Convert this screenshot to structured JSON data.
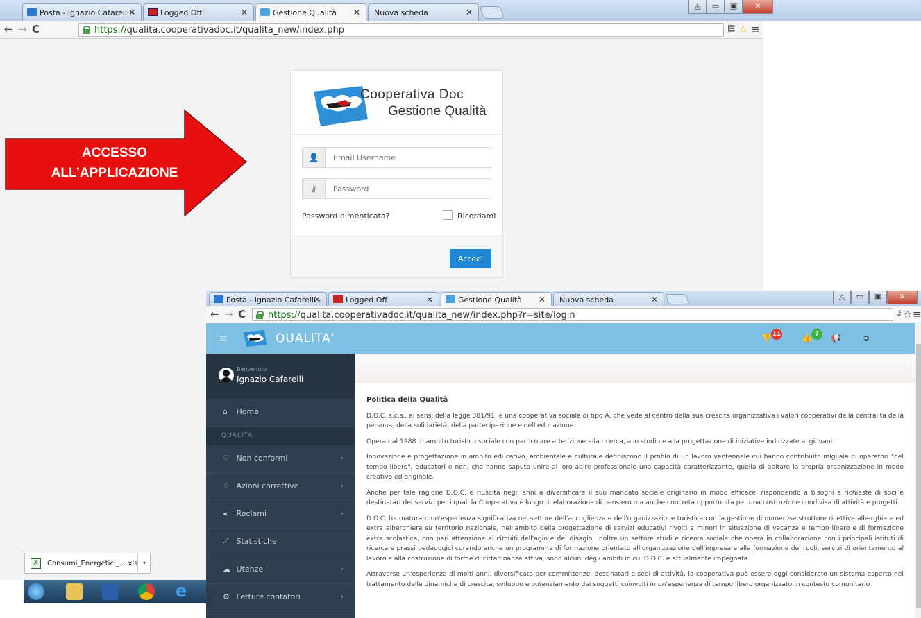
{
  "outer": {
    "tabs": [
      {
        "label": "Posta - Ignazio Cafarelli -",
        "icon": "mail-icon"
      },
      {
        "label": "Logged Off",
        "icon": "page-icon"
      },
      {
        "label": "Gestione Qualità",
        "icon": "doc-logo-icon"
      },
      {
        "label": "Nuova scheda",
        "icon": ""
      }
    ],
    "url_https": "https://",
    "url_rest": "qualita.cooperativadoc.it/qualita_new/index.php"
  },
  "login": {
    "brand_line1": "Cooperativa Doc",
    "brand_line2": "Gestione Qualità",
    "email_placeholder": "Email Username",
    "password_placeholder": "Password",
    "forgot_label": "Password dimenticata?",
    "remember_label": "Ricordami",
    "submit_label": "Accedi"
  },
  "annotation": {
    "line1": "ACCESSO",
    "line2": "ALL’APPLICAZIONE",
    "color": "#e8100f"
  },
  "inner": {
    "tabs": [
      {
        "label": "Posta - Ignazio Cafarelli -"
      },
      {
        "label": "Logged Off"
      },
      {
        "label": "Gestione Qualità"
      },
      {
        "label": "Nuova scheda"
      }
    ],
    "url_https": "https://",
    "url_rest": "qualita.cooperativadoc.it/qualita_new/index.php?r=site/login",
    "app_title": "QUALITA'",
    "header_badges": {
      "nonconformi": "11",
      "azioni": "7"
    },
    "welcome": "Benvenuto",
    "user_name": "Ignazio Cafarelli",
    "menu": {
      "home": "Home",
      "section": "QUALITA",
      "non_conformi": "Non conformi",
      "azioni": "Azioni correttive",
      "reclami": "Reclami",
      "statistiche": "Statistiche",
      "utenze": "Utenze",
      "letture": "Letture contatori"
    },
    "content": {
      "heading": "Politica della Qualità",
      "p1": "D.O.C. s.c.s., ai sensi della legge 381/91, è una cooperativa sociale di tipo A, che vede al centro della sua crescita organizzativa i valori cooperativi della centralità della persona, della solidarietà, della partecipazione e dell'educazione.",
      "p2": "Opera dal 1988 in ambito turistico sociale con particolare attenzione alla ricerca, allo studio e alla progettazione di iniziative indirizzate ai giovani.",
      "p3": "Innovazione e progettazione in ambito educativo, ambientale e culturale definiscono il profilo di un lavoro ventennale cui hanno contribuito migliaia di operatori \"del tempo libero\", educatori e non, che hanno saputo unire al loro agire professionale una capacità caratterizzante, quella di abitare la propria organizzazione in modo creativo ed originale.",
      "p4": "Anche per tale ragione D.O.C. è riuscita negli anni a diversificare il suo mandato sociale originario in modo efficace, rispondendo a bisogni e richieste di soci e destinatari dei servizi per i quali la Cooperativa è luogo di elaborazione di pensiero ma anche concreta opportunità per una costruzione condivisa di attività e progetti.",
      "p5": "D.O.C. ha maturato un'esperienza significativa nel settore dell'accoglienza e dell'organizzazione turistica con la gestione di numerose strutture ricettive alberghiere ed extra alberghiere su territorio nazionale, nell'ambito della progettazione di servizi educativi rivolti a minori in situazione di vacanza e tempo libero e di formazione extra scolastica, con pari attenzione ai circuiti dell'agio e del disagio. Inoltre un settore studi e ricerca sociale che opera in collaborazione con i principali istituti di ricerca e prassi pedagogici curando anche un programma di formazione orientato all'organizzazione dell'impresa e alla formazione dei ruoli, servizi di orientamento al lavoro e alla costruzione di forme di cittadinanza attiva, sono alcuni degli ambiti in cui D.O.C. è attualmente impegnata.",
      "p6": "Attraverso un'esperienza di molti anni, diversificata per committenze, destinatari e sedi di attività, la cooperativa può essere oggi considerato un sistema esperto nel trattamento delle dinamiche di crescita, sviluppo e potenziamento dei soggetti coinvolti in un'esperienza di tempo libero organizzato in contesto comunitario"
    }
  },
  "download": {
    "filename": "Consumi_Energetici_....xls"
  }
}
